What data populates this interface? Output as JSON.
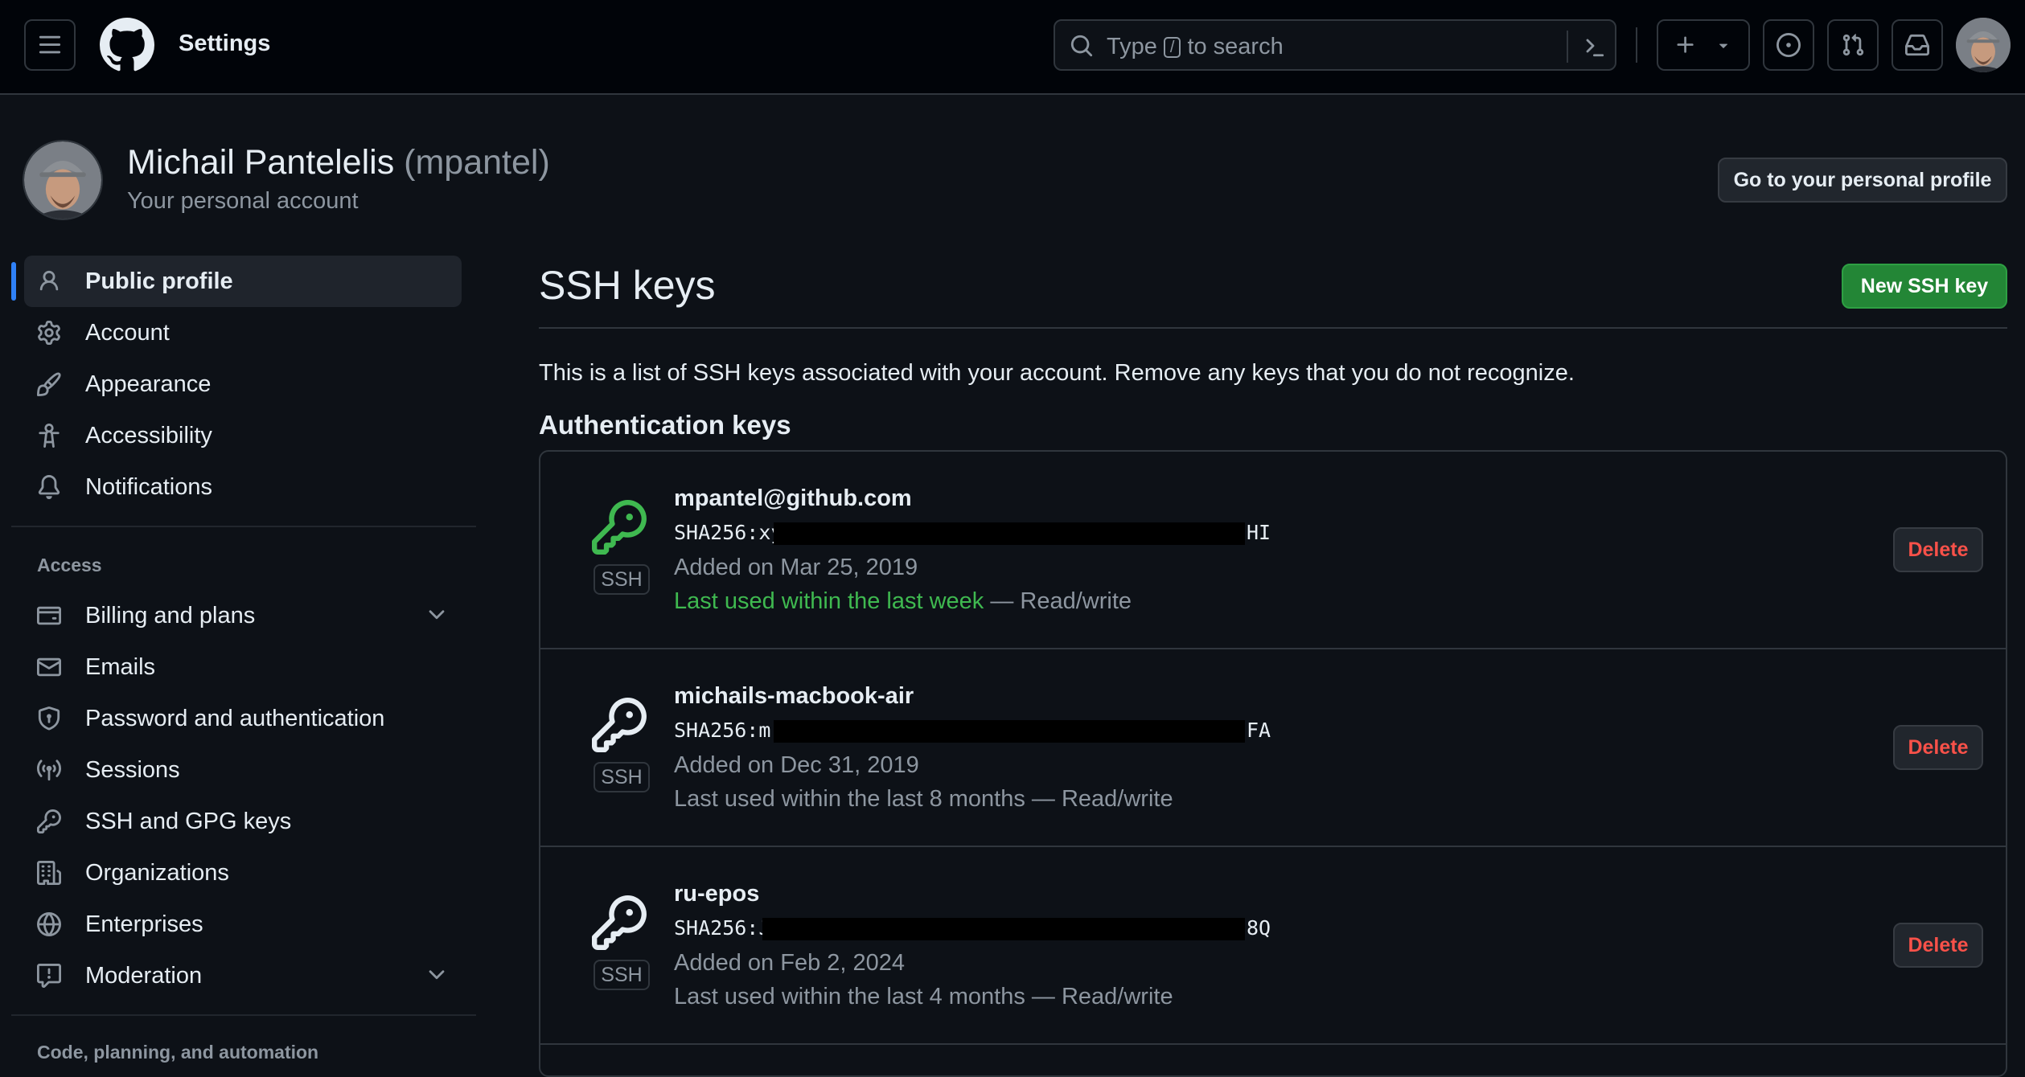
{
  "header": {
    "context_title": "Settings",
    "search": {
      "prefix": "Type",
      "key": "/",
      "suffix": "to search"
    }
  },
  "profile": {
    "name": "Michail Pantelelis",
    "handle": "(mpantel)",
    "subtitle": "Your personal account",
    "profile_button": "Go to your personal profile"
  },
  "sidebar": {
    "items": [
      {
        "label": "Public profile",
        "icon": "person-icon",
        "active": true
      },
      {
        "label": "Account",
        "icon": "gear-icon"
      },
      {
        "label": "Appearance",
        "icon": "paintbrush-icon"
      },
      {
        "label": "Accessibility",
        "icon": "accessibility-icon"
      },
      {
        "label": "Notifications",
        "icon": "bell-icon"
      }
    ],
    "access_heading": "Access",
    "access_items": [
      {
        "label": "Billing and plans",
        "icon": "credit-card-icon",
        "expandable": true
      },
      {
        "label": "Emails",
        "icon": "mail-icon"
      },
      {
        "label": "Password and authentication",
        "icon": "shield-lock-icon"
      },
      {
        "label": "Sessions",
        "icon": "broadcast-icon"
      },
      {
        "label": "SSH and GPG keys",
        "icon": "key-icon"
      },
      {
        "label": "Organizations",
        "icon": "organization-icon"
      },
      {
        "label": "Enterprises",
        "icon": "globe-icon"
      },
      {
        "label": "Moderation",
        "icon": "report-icon",
        "expandable": true
      }
    ],
    "next_heading": "Code, planning, and automation"
  },
  "main": {
    "title": "SSH keys",
    "new_button": "New SSH key",
    "intro": "This is a list of SSH keys associated with your account. Remove any keys that you do not recognize.",
    "auth_heading": "Authentication keys",
    "keys": [
      {
        "title": "mpantel@github.com",
        "fingerprint_start": "SHA256:xy",
        "fingerprint_end": "HI",
        "added": "Added on Mar 25, 2019",
        "last_used_recent": "Last used within the last week",
        "last_used_rest": " — Read/write",
        "badge": "SSH",
        "delete": "Delete",
        "key_color": "#3fb950"
      },
      {
        "title": "michails-macbook-air",
        "fingerprint_start": "SHA256:m(",
        "fingerprint_end": "FA",
        "added": "Added on Dec 31, 2019",
        "last_used_recent": "",
        "last_used_rest": "Last used within the last 8 months — Read/write",
        "badge": "SSH",
        "delete": "Delete",
        "key_color": "#e6edf3"
      },
      {
        "title": "ru-epos",
        "fingerprint_start": "SHA256:J",
        "fingerprint_end": "8Q",
        "added": "Added on Feb 2, 2024",
        "last_used_recent": "",
        "last_used_rest": "Last used within the last 4 months — Read/write",
        "badge": "SSH",
        "delete": "Delete",
        "key_color": "#e6edf3"
      }
    ]
  },
  "colors": {
    "background": "#0d1117",
    "header": "#010409",
    "border": "#30363d",
    "accent_blue": "#2f81f7",
    "success_green": "#238636",
    "danger_red": "#f85149",
    "muted_text": "#8d96a0"
  }
}
